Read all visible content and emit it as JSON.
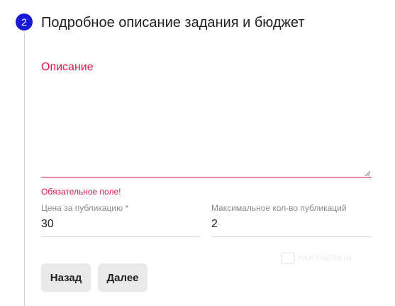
{
  "step": {
    "number": "2",
    "title": "Подробное описание задания и бюджет"
  },
  "description": {
    "label": "Описание",
    "value": "",
    "error": "Обязательное поле!"
  },
  "price": {
    "label": "Цена за публикацию *",
    "value": "30"
  },
  "max_publications": {
    "label": "Максимальное кол-во публикаций",
    "value": "2"
  },
  "watermark": {
    "text": "PARTNERKIN"
  },
  "buttons": {
    "back": "Назад",
    "next": "Далее"
  },
  "colors": {
    "accent": "#1a1ad6",
    "error": "#e0144c",
    "button_bg": "#e9e9ec"
  }
}
